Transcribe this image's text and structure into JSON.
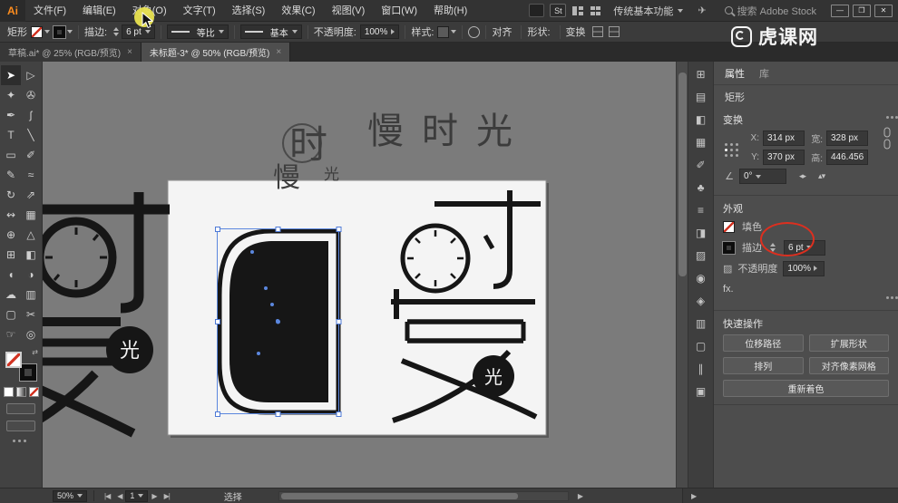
{
  "colors": {
    "selection_blue": "#5b87de",
    "annotation_red": "#dd2f1f",
    "highlight_yellow": "#e9e350",
    "logo_orange": "#ff8d1e",
    "artwork_black": "#161616"
  },
  "menubar": {
    "logo": "Ai",
    "items": [
      "文件(F)",
      "编辑(E)",
      "对象(O)",
      "文字(T)",
      "选择(S)",
      "效果(C)",
      "视图(V)",
      "窗口(W)",
      "帮助(H)"
    ],
    "stock_badge": "St",
    "gpu_glyph": "✈",
    "workspace": "传统基本功能",
    "search_placeholder": "搜索 Adobe Stock",
    "window_controls": {
      "minimize": "—",
      "restore": "❐",
      "close": "✕"
    }
  },
  "controlbar": {
    "tool_label": "矩形",
    "stroke_label": "描边:",
    "stroke_value": "6 pt",
    "profile_value": "等比",
    "brush_value": "基本",
    "opacity_label": "不透明度:",
    "opacity_value": "100%",
    "style_label": "样式:",
    "align_label": "对齐",
    "shape_label": "形状:",
    "transform_label": "变换",
    "watermark": "虎课网"
  },
  "tabbar": {
    "tabs": [
      {
        "label": "草稿.ai* @ 25% (RGB/预览)",
        "close": "×"
      },
      {
        "label": "未标题-3* @ 50% (RGB/预览)",
        "close": "×"
      }
    ]
  },
  "toolbar": {
    "swap_glyph": "⇄",
    "tools": [
      {
        "name": "selection-tool",
        "glyph": "➤"
      },
      {
        "name": "direct-selection-tool",
        "glyph": "▷"
      },
      {
        "name": "magic-wand-tool",
        "glyph": "✦"
      },
      {
        "name": "lasso-tool",
        "glyph": "✇"
      },
      {
        "name": "pen-tool",
        "glyph": "✒"
      },
      {
        "name": "curvature-tool",
        "glyph": "ʃ"
      },
      {
        "name": "type-tool",
        "glyph": "T"
      },
      {
        "name": "line-segment-tool",
        "glyph": "╲"
      },
      {
        "name": "rectangle-tool",
        "glyph": "▭"
      },
      {
        "name": "paintbrush-tool",
        "glyph": "✐"
      },
      {
        "name": "pencil-tool",
        "glyph": "✎"
      },
      {
        "name": "shaper-tool",
        "glyph": "≈"
      },
      {
        "name": "rotate-tool",
        "glyph": "↻"
      },
      {
        "name": "scale-tool",
        "glyph": "⇗"
      },
      {
        "name": "width-tool",
        "glyph": "↭"
      },
      {
        "name": "free-transform-tool",
        "glyph": "▦"
      },
      {
        "name": "shape-builder-tool",
        "glyph": "⊕"
      },
      {
        "name": "perspective-grid-tool",
        "glyph": "△"
      },
      {
        "name": "mesh-tool",
        "glyph": "⊞"
      },
      {
        "name": "gradient-tool",
        "glyph": "◧"
      },
      {
        "name": "eyedropper-tool",
        "glyph": "◖"
      },
      {
        "name": "blend-tool",
        "glyph": "◑"
      },
      {
        "name": "symbol-sprayer-tool",
        "glyph": "☁"
      },
      {
        "name": "column-graph-tool",
        "glyph": "▥"
      },
      {
        "name": "artboard-tool",
        "glyph": "▢"
      },
      {
        "name": "slice-tool",
        "glyph": "✂"
      },
      {
        "name": "hand-tool",
        "glyph": "☞"
      },
      {
        "name": "zoom-tool",
        "glyph": "◎"
      }
    ]
  },
  "strip": {
    "icons": [
      {
        "name": "panel-grid-icon",
        "glyph": "⊞"
      },
      {
        "name": "color-panel-icon",
        "glyph": "▤"
      },
      {
        "name": "color-guide-panel-icon",
        "glyph": "◧"
      },
      {
        "name": "swatches-panel-icon",
        "glyph": "▦"
      },
      {
        "name": "brushes-panel-icon",
        "glyph": "✐"
      },
      {
        "name": "symbols-panel-icon",
        "glyph": "♣"
      },
      {
        "name": "stroke-panel-icon",
        "glyph": "≡"
      },
      {
        "name": "gradient-panel-icon",
        "glyph": "◨"
      },
      {
        "name": "transparency-panel-icon",
        "glyph": "▨"
      },
      {
        "name": "appearance-panel-icon",
        "glyph": "◉"
      },
      {
        "name": "graphic-styles-panel-icon",
        "glyph": "◈"
      },
      {
        "name": "layers-panel-icon",
        "glyph": "▥"
      },
      {
        "name": "artboards-panel-icon",
        "glyph": "▢"
      },
      {
        "name": "align-panel-icon",
        "glyph": "∥"
      },
      {
        "name": "asset-export-panel-icon",
        "glyph": "▣"
      }
    ]
  },
  "canvas": {
    "title_text": "慢时光",
    "draft_shi": "时",
    "draft_man": "慢",
    "draft_guang": "光",
    "circle_guang": "光"
  },
  "panel": {
    "tabs": [
      "属性",
      "库"
    ],
    "object_label": "矩形",
    "transform": {
      "title": "变换",
      "x_label": "X:",
      "x_value": "314 px",
      "y_label": "Y:",
      "y_value": "370 px",
      "w_label": "宽:",
      "w_value": "328 px",
      "h_label": "高:",
      "h_value": "446.456",
      "angle_icon": "∠",
      "angle_value": "0°",
      "flip_h": "◂▸",
      "flip_v": "▴▾"
    },
    "appearance": {
      "title": "外观",
      "fill_label": "填色",
      "stroke_label": "描边",
      "stroke_value": "6 pt",
      "opacity_icon": "▨",
      "opacity_label": "不透明度",
      "opacity_value": "100%",
      "fx_label": "fx."
    },
    "quick_actions": {
      "title": "快速操作",
      "buttons": [
        "位移路径",
        "扩展形状",
        "排列",
        "对齐像素网格",
        "重新着色"
      ]
    }
  },
  "statusbar": {
    "zoom": "50%",
    "nav": {
      "first": "|◀",
      "prev": "◀",
      "next": "▶",
      "last": "▶|"
    },
    "artboard_value": "1",
    "status": "选择"
  }
}
